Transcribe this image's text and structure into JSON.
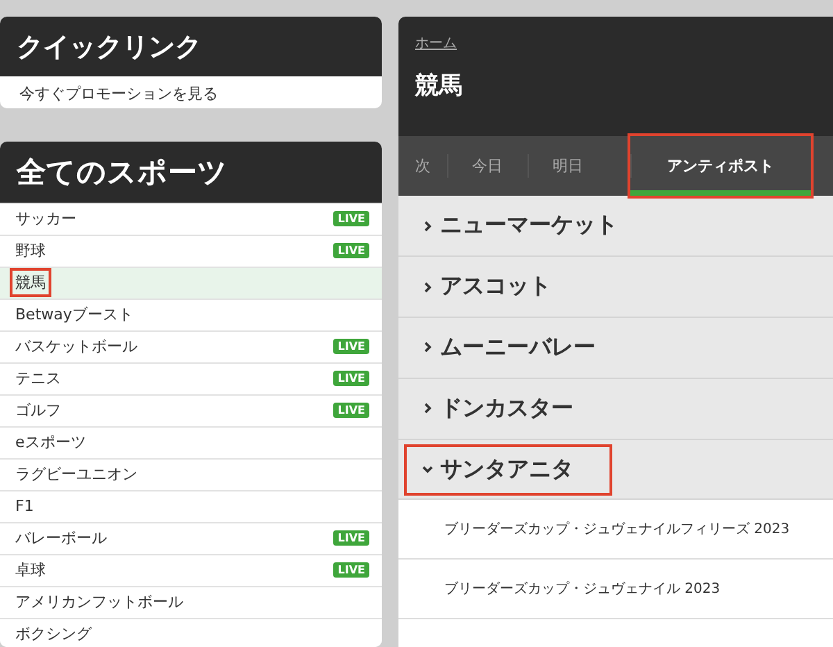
{
  "quick_links": {
    "title": "クイックリンク",
    "items": [
      "今すぐプロモーションを見る"
    ]
  },
  "all_sports": {
    "title": "全てのスポーツ",
    "items": [
      {
        "label": "サッカー",
        "live": "LIVE",
        "selected": false,
        "highlighted": false
      },
      {
        "label": "野球",
        "live": "LIVE",
        "selected": false,
        "highlighted": false
      },
      {
        "label": "競馬",
        "selected": true,
        "highlighted": true
      },
      {
        "label": "Betwayブースト",
        "selected": false,
        "highlighted": false
      },
      {
        "label": "バスケットボール",
        "live": "LIVE",
        "selected": false,
        "highlighted": false
      },
      {
        "label": "テニス",
        "live": "LIVE",
        "selected": false,
        "highlighted": false
      },
      {
        "label": "ゴルフ",
        "live": "LIVE",
        "selected": false,
        "highlighted": false
      },
      {
        "label": "eスポーツ",
        "selected": false,
        "highlighted": false
      },
      {
        "label": "ラグビーユニオン",
        "selected": false,
        "highlighted": false
      },
      {
        "label": "F1",
        "selected": false,
        "highlighted": false
      },
      {
        "label": "バレーボール",
        "live": "LIVE",
        "selected": false,
        "highlighted": false
      },
      {
        "label": "卓球",
        "live": "LIVE",
        "selected": false,
        "highlighted": false
      },
      {
        "label": "アメリカンフットボール",
        "selected": false,
        "highlighted": false
      },
      {
        "label": "ボクシング",
        "selected": false,
        "highlighted": false
      }
    ]
  },
  "header": {
    "breadcrumb": "ホーム",
    "title": "競馬"
  },
  "tabs": [
    {
      "label": "次",
      "selected": false,
      "highlighted": false
    },
    {
      "label": "今日",
      "selected": false,
      "highlighted": false
    },
    {
      "label": "明日",
      "selected": false,
      "highlighted": false
    },
    {
      "label": "アンティポスト",
      "selected": true,
      "highlighted": true
    }
  ],
  "meetings": [
    {
      "name": "ニューマーケット",
      "expanded": false,
      "highlighted": false
    },
    {
      "name": "アスコット",
      "expanded": false,
      "highlighted": false
    },
    {
      "name": "ムーニーバレー",
      "expanded": false,
      "highlighted": false
    },
    {
      "name": "ドンカスター",
      "expanded": false,
      "highlighted": false
    },
    {
      "name": "サンタアニタ",
      "expanded": true,
      "highlighted": true,
      "races": [
        "ブリーダーズカップ・ジュヴェナイルフィリーズ 2023",
        "ブリーダーズカップ・ジュヴェナイル 2023"
      ]
    }
  ]
}
